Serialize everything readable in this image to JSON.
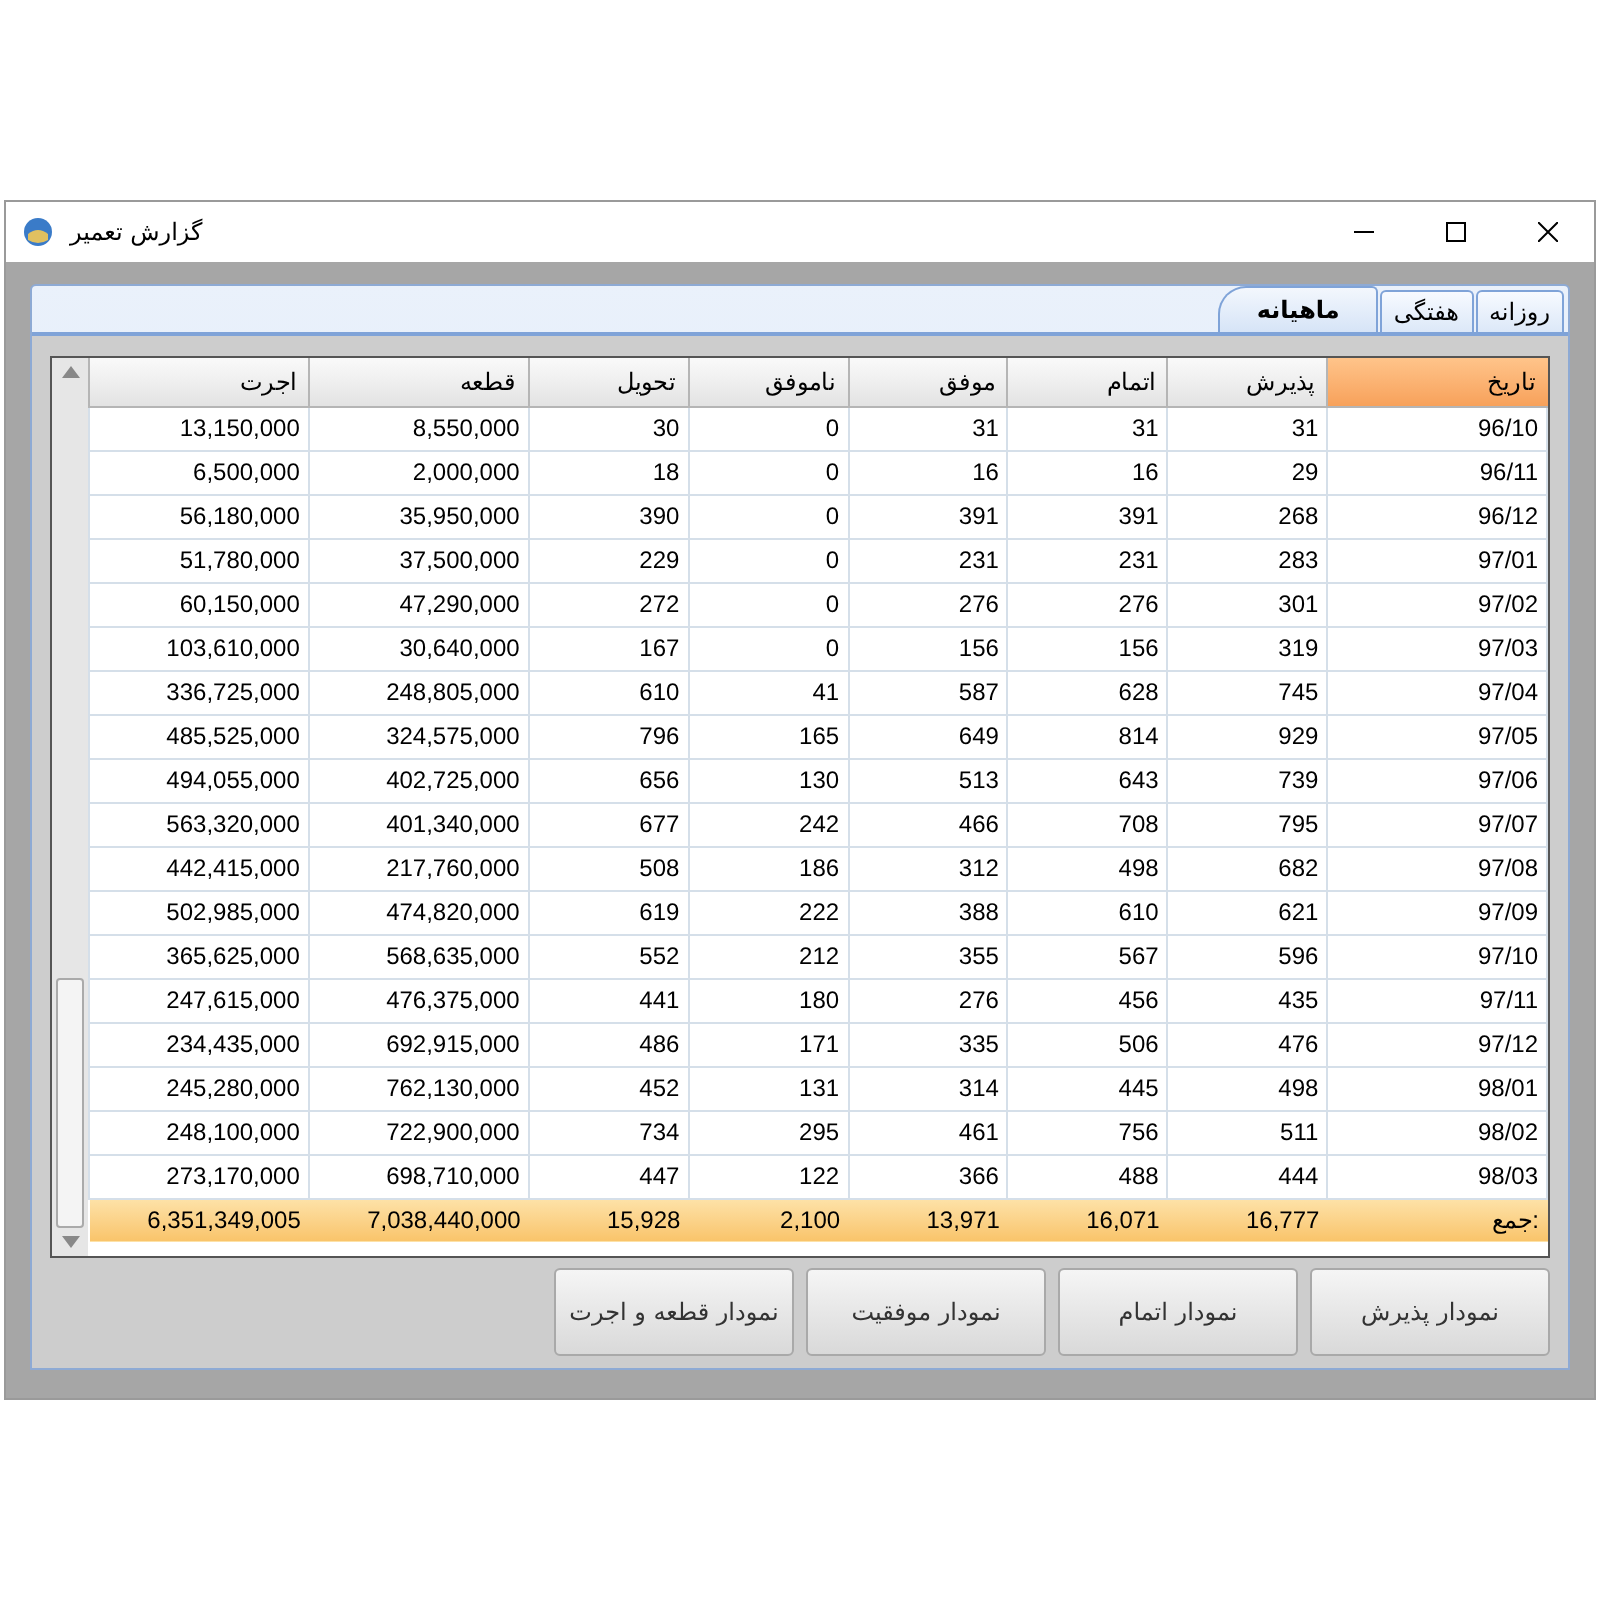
{
  "window": {
    "title": "گزارش تعمیر"
  },
  "tabs": [
    {
      "label": "روزانه",
      "selected": false
    },
    {
      "label": "هفتگی",
      "selected": false
    },
    {
      "label": "ماهیانه",
      "selected": true
    }
  ],
  "table": {
    "columns": [
      {
        "label": "اجرت",
        "sorted": false
      },
      {
        "label": "قطعه",
        "sorted": false
      },
      {
        "label": "تحویل",
        "sorted": false
      },
      {
        "label": "ناموفق",
        "sorted": false
      },
      {
        "label": "موفق",
        "sorted": false
      },
      {
        "label": "اتمام",
        "sorted": false
      },
      {
        "label": "پذیرش",
        "sorted": false
      },
      {
        "label": "تاریخ",
        "sorted": true
      }
    ],
    "rows": [
      [
        "13,150,000",
        "8,550,000",
        "30",
        "0",
        "31",
        "31",
        "31",
        "96/10"
      ],
      [
        "6,500,000",
        "2,000,000",
        "18",
        "0",
        "16",
        "16",
        "29",
        "96/11"
      ],
      [
        "56,180,000",
        "35,950,000",
        "390",
        "0",
        "391",
        "391",
        "268",
        "96/12"
      ],
      [
        "51,780,000",
        "37,500,000",
        "229",
        "0",
        "231",
        "231",
        "283",
        "97/01"
      ],
      [
        "60,150,000",
        "47,290,000",
        "272",
        "0",
        "276",
        "276",
        "301",
        "97/02"
      ],
      [
        "103,610,000",
        "30,640,000",
        "167",
        "0",
        "156",
        "156",
        "319",
        "97/03"
      ],
      [
        "336,725,000",
        "248,805,000",
        "610",
        "41",
        "587",
        "628",
        "745",
        "97/04"
      ],
      [
        "485,525,000",
        "324,575,000",
        "796",
        "165",
        "649",
        "814",
        "929",
        "97/05"
      ],
      [
        "494,055,000",
        "402,725,000",
        "656",
        "130",
        "513",
        "643",
        "739",
        "97/06"
      ],
      [
        "563,320,000",
        "401,340,000",
        "677",
        "242",
        "466",
        "708",
        "795",
        "97/07"
      ],
      [
        "442,415,000",
        "217,760,000",
        "508",
        "186",
        "312",
        "498",
        "682",
        "97/08"
      ],
      [
        "502,985,000",
        "474,820,000",
        "619",
        "222",
        "388",
        "610",
        "621",
        "97/09"
      ],
      [
        "365,625,000",
        "568,635,000",
        "552",
        "212",
        "355",
        "567",
        "596",
        "97/10"
      ],
      [
        "247,615,000",
        "476,375,000",
        "441",
        "180",
        "276",
        "456",
        "435",
        "97/11"
      ],
      [
        "234,435,000",
        "692,915,000",
        "486",
        "171",
        "335",
        "506",
        "476",
        "97/12"
      ],
      [
        "245,280,000",
        "762,130,000",
        "452",
        "131",
        "314",
        "445",
        "498",
        "98/01"
      ],
      [
        "248,100,000",
        "722,900,000",
        "734",
        "295",
        "461",
        "756",
        "511",
        "98/02"
      ],
      [
        "273,170,000",
        "698,710,000",
        "447",
        "122",
        "366",
        "488",
        "444",
        "98/03"
      ]
    ],
    "total": [
      "6,351,349,005",
      "7,038,440,000",
      "15,928",
      "2,100",
      "13,971",
      "16,071",
      "16,777",
      "جمع:"
    ]
  },
  "buttons": [
    "نمودار پذیرش",
    "نمودار اتمام",
    "نمودار موفقیت",
    "نمودار قطعه و اجرت"
  ]
}
